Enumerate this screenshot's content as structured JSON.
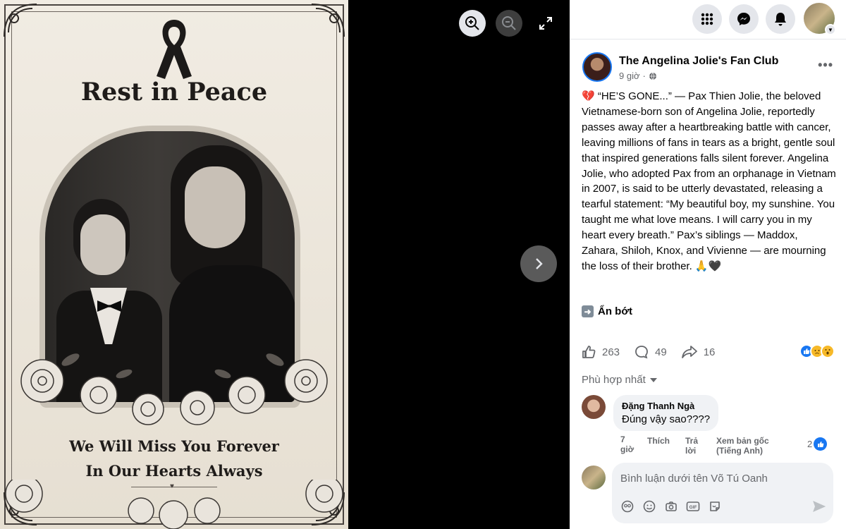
{
  "poster": {
    "title": "Rest in Peace",
    "subtitle_line1": "We Will Miss You Forever",
    "subtitle_line2": "In Our Hearts Always"
  },
  "viewer": {
    "zoom_in_icon": "zoom-in-icon",
    "zoom_out_icon": "zoom-out-icon",
    "fullscreen_icon": "fullscreen-icon",
    "next_icon": "chevron-right-icon"
  },
  "topbar": {
    "icons": [
      "apps-grid-icon",
      "messenger-icon",
      "bell-icon"
    ]
  },
  "post": {
    "page_name": "The Angelina Jolie's Fan Club",
    "time": "9 giờ",
    "audience_icon": "globe-icon",
    "text": "💔 “HE’S GONE...” — Pax Thien Jolie, the beloved Vietnamese-born son of Angelina Jolie, reportedly passes away after a heartbreaking battle with cancer, leaving millions of fans in tears as a bright, gentle soul that inspired generations falls silent forever. Angelina Jolie, who adopted Pax from an orphanage in Vietnam in 2007, is said to be utterly devastated, releasing a tearful statement: “My beautiful boy, my sunshine. You taught me what love means. I will carry you in my heart every breath.” Pax’s siblings — Maddox, Zahara, Shiloh, Knox, and Vivienne — are mourning the loss of their brother. 🙏🖤",
    "see_less": "Ẩn bớt",
    "likes": "263",
    "comments": "49",
    "shares": "16"
  },
  "comments": {
    "sort_label": "Phù hợp nhất",
    "items": [
      {
        "author": "Đặng Thanh Ngà",
        "text": "Đúng vậy sao????",
        "time": "7 giờ",
        "like": "Thích",
        "reply": "Trả lời",
        "translate": "Xem bản gốc (Tiếng Anh)",
        "like_count": "2"
      }
    ],
    "composer_placeholder": "Bình luận dưới tên Võ Tú Oanh"
  },
  "colors": {
    "accent": "#1877f2",
    "text": "#050505",
    "muted": "#65676b"
  }
}
